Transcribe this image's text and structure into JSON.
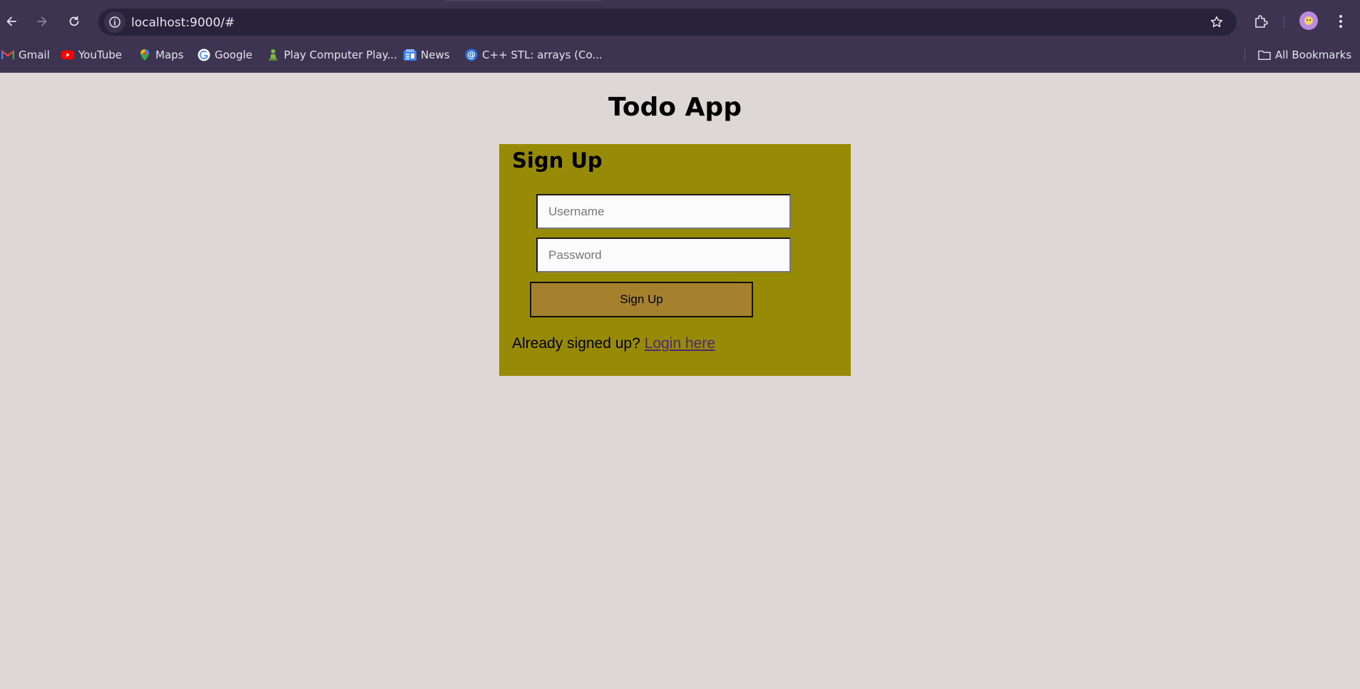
{
  "browser": {
    "url": "localhost:9000/#",
    "bookmarks": [
      {
        "label": "Gmail",
        "icon": "gmail-icon"
      },
      {
        "label": "YouTube",
        "icon": "youtube-icon"
      },
      {
        "label": "Maps",
        "icon": "maps-icon"
      },
      {
        "label": "Google",
        "icon": "google-icon"
      },
      {
        "label": "Play Computer Play...",
        "icon": "chess-pawn-icon"
      },
      {
        "label": "News",
        "icon": "news-icon"
      },
      {
        "label": "C++ STL: arrays (Co...",
        "icon": "at-sign-icon"
      }
    ],
    "all_bookmarks_label": "All Bookmarks"
  },
  "page": {
    "title": "Todo App",
    "form": {
      "heading": "Sign Up",
      "username_placeholder": "Username",
      "username_value": "",
      "password_placeholder": "Password",
      "password_value": "",
      "submit_label": "Sign Up",
      "login_prompt": "Already signed up?",
      "login_link": "Login here"
    }
  },
  "colors": {
    "page_bg": "#ddd7d7",
    "card_bg": "#978a07",
    "button_bg": "#a5812e",
    "link": "#4f2a72",
    "chrome_bg": "#3c3450",
    "omnibox_bg": "#28223a"
  }
}
